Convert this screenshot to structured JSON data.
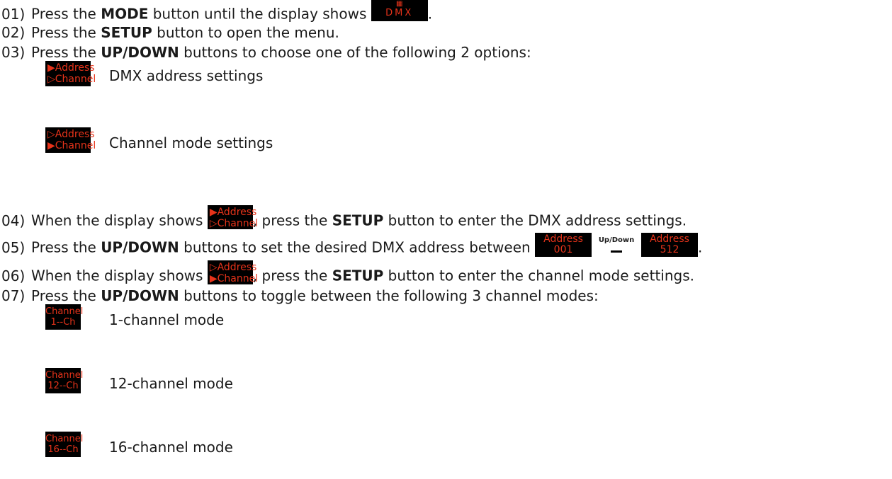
{
  "steps": {
    "s01": {
      "num": "01)",
      "pre": "Press the ",
      "b1": "MODE",
      "post": " button until the display shows ",
      "end": "."
    },
    "s02": {
      "num": "02)",
      "pre": "Press the ",
      "b1": "SETUP",
      "post": " button to open the menu."
    },
    "s03": {
      "num": "03)",
      "pre": "Press the ",
      "b1": "UP/DOWN",
      "post": " buttons to choose one of the following 2 options:"
    },
    "s04": {
      "num": "04)",
      "pre": "When the display shows ",
      "mid": ", press the ",
      "b1": "SETUP",
      "post": " button to enter the DMX address settings."
    },
    "s05": {
      "num": "05)",
      "pre": "Press the ",
      "b1": "UP/DOWN",
      "post": " buttons to set the desired DMX address between ",
      "end": "."
    },
    "s06": {
      "num": "06)",
      "pre": "When the display shows ",
      "mid": ", press the ",
      "b1": "SETUP",
      "post": " button to enter the channel mode settings."
    },
    "s07": {
      "num": "07)",
      "pre": "Press the ",
      "b1": "UP/DOWN",
      "post": " buttons to toggle between the following 3 channel modes:"
    }
  },
  "display": {
    "dmx": "DMX",
    "address": "Address",
    "channel": "Channel",
    "arrow_filled": "▶",
    "arrow_hollow": "▷",
    "addr_min": "001",
    "addr_max": "512",
    "updown": "Up/Down",
    "mode1": "1--Ch",
    "mode12": "12--Ch",
    "mode16": "16--Ch"
  },
  "options": {
    "address_desc": "DMX address settings",
    "channel_desc": "Channel mode settings"
  },
  "modes": {
    "m1": "1-channel mode",
    "m12": "12-channel mode",
    "m16": "16-channel mode"
  },
  "colors": {
    "lcd_bg": "#000000",
    "lcd_text": "#e6331a"
  }
}
